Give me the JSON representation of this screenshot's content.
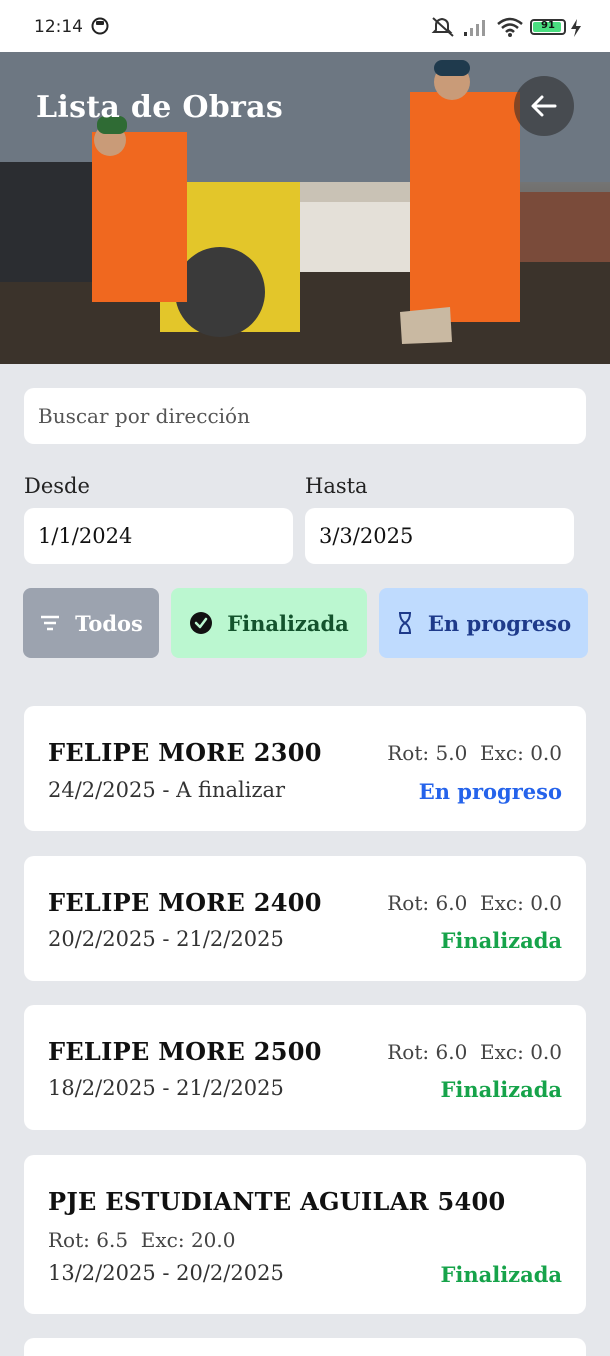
{
  "status_bar": {
    "time": "12:14",
    "battery": "91"
  },
  "header": {
    "title": "Lista de Obras"
  },
  "search": {
    "placeholder": "Buscar por dirección",
    "value": ""
  },
  "date_range": {
    "from_label": "Desde",
    "from_value": "1/1/2024",
    "to_label": "Hasta",
    "to_value": "3/3/2025"
  },
  "filters": [
    {
      "label": "Todos",
      "icon": "filter-icon",
      "color": "#9ca3af"
    },
    {
      "label": "Finalizada",
      "icon": "check-circle-icon",
      "color": "#bbf7d0"
    },
    {
      "label": "En progreso",
      "icon": "hourglass-icon",
      "color": "#bfdbfe"
    }
  ],
  "obras": [
    {
      "address": "FELIPE MORE 2300",
      "rot": "Rot: 5.0",
      "exc": "Exc: 0.0",
      "dates": "24/2/2025 - A finalizar",
      "status": "En progreso"
    },
    {
      "address": "FELIPE MORE 2400",
      "rot": "Rot: 6.0",
      "exc": "Exc: 0.0",
      "dates": "20/2/2025 - 21/2/2025",
      "status": "Finalizada"
    },
    {
      "address": "FELIPE MORE 2500",
      "rot": "Rot: 6.0",
      "exc": "Exc: 0.0",
      "dates": "18/2/2025 - 21/2/2025",
      "status": "Finalizada"
    },
    {
      "address": "PJE ESTUDIANTE AGUILAR 5400",
      "rot": "Rot: 6.5",
      "exc": "Exc: 20.0",
      "dates": "13/2/2025 - 20/2/2025",
      "status": "Finalizada"
    }
  ],
  "colors": {
    "finalizada": "#16a34a",
    "en_progreso": "#2563eb",
    "background": "#e5e7eb"
  }
}
